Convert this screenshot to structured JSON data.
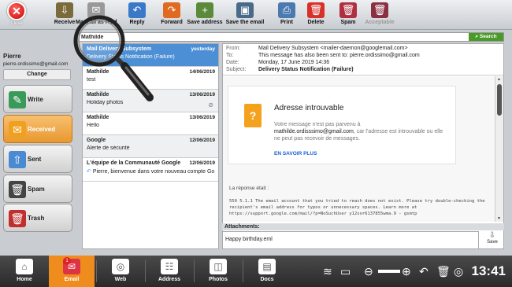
{
  "toolbar": {
    "close": "Close",
    "buttons": [
      {
        "label": "Receive",
        "icon": "receive-icon",
        "color": "#7b6a3a",
        "glyph": "⇩"
      },
      {
        "label": "Mark all as read",
        "icon": "mark-read-icon",
        "color": "#999999",
        "glyph": "✉"
      },
      {
        "label": "Reply",
        "icon": "reply-icon",
        "color": "#3a78c8",
        "glyph": "↶"
      },
      {
        "label": "Forward",
        "icon": "forward-icon",
        "color": "#e06a20",
        "glyph": "↷"
      },
      {
        "label": "Save address",
        "icon": "save-address-icon",
        "color": "#5a8a3a",
        "glyph": "+"
      },
      {
        "label": "Save the email",
        "icon": "save-email-icon",
        "color": "#4a6a8a",
        "glyph": "▣"
      },
      {
        "label": "Print",
        "icon": "print-icon",
        "color": "#4a7ab0",
        "glyph": "⎙"
      },
      {
        "label": "Delete",
        "icon": "delete-icon",
        "color": "#d8302a",
        "glyph": "🗑"
      },
      {
        "label": "Spam",
        "icon": "spam-icon",
        "color": "#b03040",
        "glyph": "🗑"
      },
      {
        "label": "Acceptable",
        "icon": "acceptable-icon",
        "color": "#8a3040",
        "glyph": "🗑"
      }
    ]
  },
  "user": {
    "name": "Pierre",
    "email": "pierre.ordissimo@gmail.com",
    "change": "Change"
  },
  "sidebar": {
    "items": [
      {
        "label": "Write",
        "icon": "write-icon",
        "color": "#3a9a5a",
        "glyph": "✎",
        "active": false
      },
      {
        "label": "Received",
        "icon": "received-icon",
        "color": "#f0a020",
        "glyph": "✉",
        "active": true
      },
      {
        "label": "Sent",
        "icon": "sent-icon",
        "color": "#4a8ad0",
        "glyph": "⇧",
        "active": false
      },
      {
        "label": "Spam",
        "icon": "spam-folder-icon",
        "color": "#444444",
        "glyph": "🗑",
        "active": false
      },
      {
        "label": "Trash",
        "icon": "trash-icon",
        "color": "#c03030",
        "glyph": "🗑",
        "active": false
      }
    ]
  },
  "search": {
    "value": "Mathilde",
    "button": "Search"
  },
  "messages": [
    {
      "from": "Mail Delivery Subsystem",
      "date": "yesterday",
      "subject": "Delivery Status Notification (Failure)",
      "selected": true
    },
    {
      "from": "Mathilde",
      "date": "14/06/2019",
      "subject": "test",
      "selected": false
    },
    {
      "from": "Mathilde",
      "date": "13/06/2019",
      "subject": "Holiday photos",
      "selected": false
    },
    {
      "from": "Mathilde",
      "date": "13/06/2019",
      "subject": "Hello",
      "selected": false
    },
    {
      "from": "Google",
      "date": "12/06/2019",
      "subject": "Alerte de sécurité",
      "selected": false
    },
    {
      "from": "L'équipe de la Communauté Google",
      "date": "12/06/2019",
      "subject": "Pierre, bienvenue dans votre nouveau compte Go...",
      "selected": false
    }
  ],
  "email": {
    "from_label": "From:",
    "from": "Mail Delivery Subsystem <mailer-daemon@googlemail.com>",
    "to_label": "To:",
    "to": "This message has also been sent to: pierre.ordissimo@gmail.com",
    "date_label": "Date:",
    "date": "Monday, 17 June 2019 14:36",
    "subject_label": "Subject:",
    "subject": "Delivery Status Notification (Failure)",
    "card_title": "Adresse introuvable",
    "card_text_1": "Votre message n'est pas parvenu à",
    "card_address": "mathilde.ordisssimo@gmail.com",
    "card_text_2": ", car l'adresse est introuvable ou elle ne peut pas recevoir de messages.",
    "card_link": "EN SAVOIR PLUS",
    "reply_label": "La réponse était :",
    "reply_text": "550 5.1.1 The email account that you tried to reach does not exist. Please try double-checking the recipient's email address for typos or unnecessary spaces. Learn more at https://support.google.com/mail/?p=NoSuchUser y12sor6137855wma.9 - gsmtp"
  },
  "attachments": {
    "label": "Attachments:",
    "file": "Happy birthday.eml",
    "save": "Save"
  },
  "taskbar": {
    "items": [
      {
        "label": "Home",
        "icon": "home-icon",
        "glyph": "⌂"
      },
      {
        "label": "Email",
        "icon": "email-icon",
        "glyph": "✉"
      },
      {
        "label": "Web",
        "icon": "web-icon",
        "glyph": "◎"
      },
      {
        "label": "Address",
        "icon": "address-icon",
        "glyph": "☷"
      },
      {
        "label": "Photos",
        "icon": "photos-icon",
        "glyph": "◫"
      },
      {
        "label": "Docs",
        "icon": "docs-icon",
        "glyph": "▤"
      }
    ],
    "email_badge": "1",
    "clock": "13:41"
  }
}
